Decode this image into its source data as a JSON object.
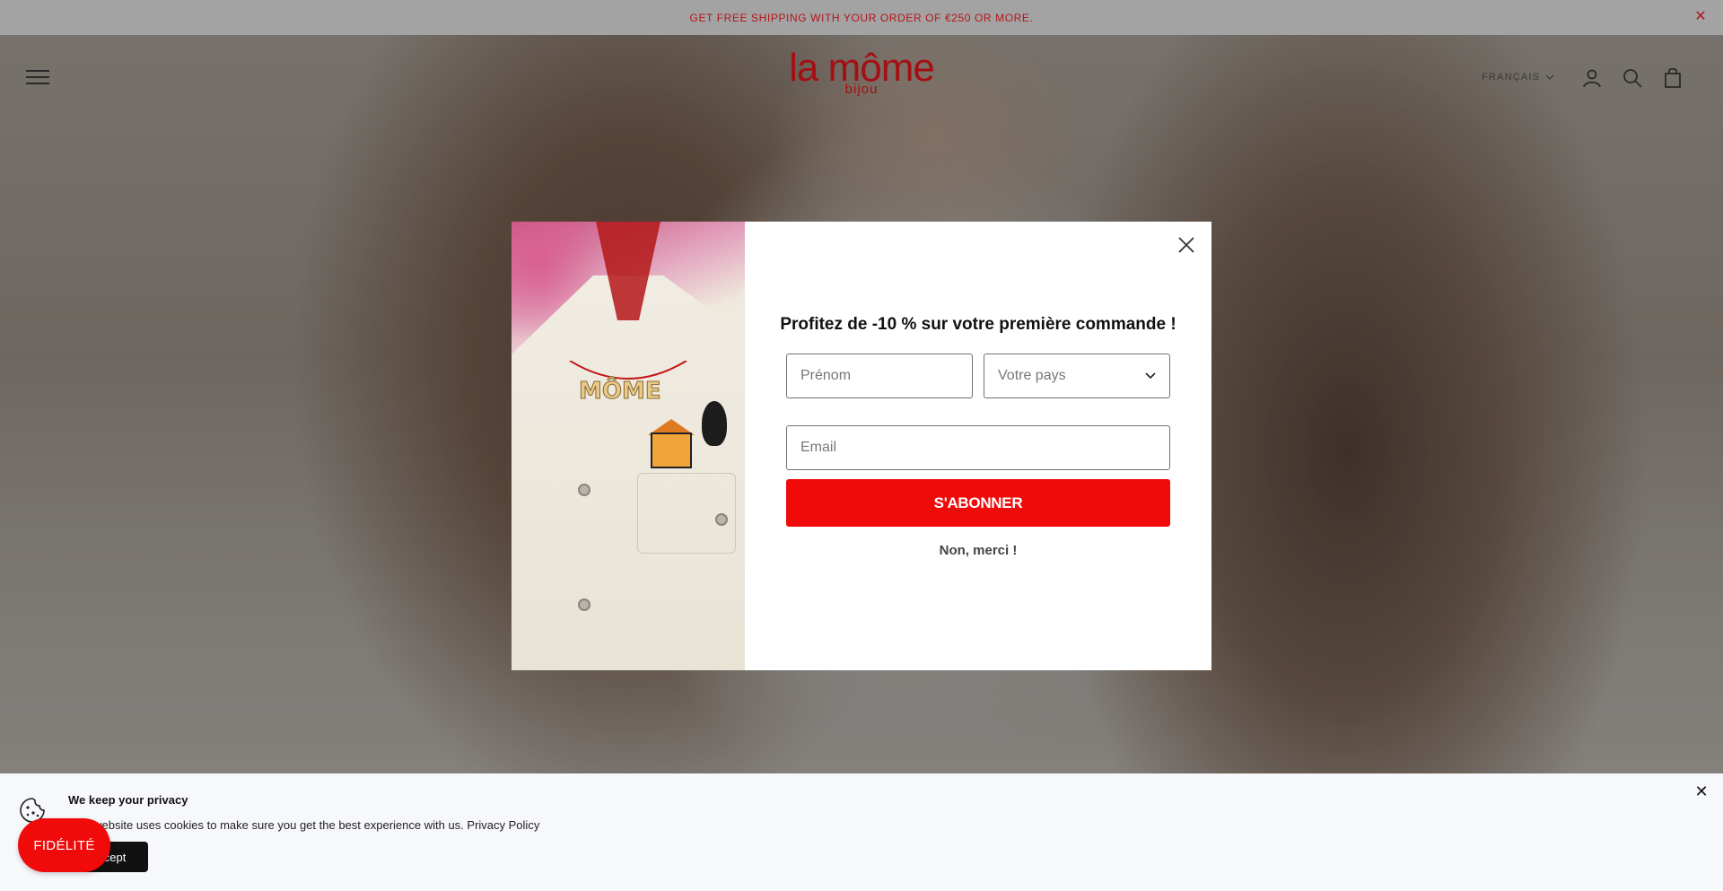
{
  "announcement": {
    "text": "GET FREE SHIPPING WITH YOUR ORDER OF €250 OR MORE.",
    "close_icon": "close-icon"
  },
  "header": {
    "logo_main": "la môme",
    "logo_sub": "bijou",
    "language": "FRANÇAIS",
    "icons": [
      "menu-icon",
      "account-icon",
      "search-icon",
      "cart-icon"
    ]
  },
  "popup": {
    "title": "Profitez de -10 % sur votre première commande !",
    "first_name_placeholder": "Prénom",
    "country_placeholder": "Votre pays",
    "email_placeholder": "Email",
    "subscribe_label": "S'ABONNER",
    "decline_label": "Non, merci !",
    "image_text": "MÔME"
  },
  "cookie_banner": {
    "title": "We keep your privacy",
    "text": "This website uses cookies to make sure you get the best experience with us.",
    "policy_link": "Privacy Policy",
    "accept_label": "Accept"
  },
  "loyalty_button": {
    "label": "FIDÉLITÉ"
  },
  "colors": {
    "brand_red": "#a40f13",
    "cta_red": "#f00a0a",
    "announce_bg": "#a3a3a3"
  }
}
